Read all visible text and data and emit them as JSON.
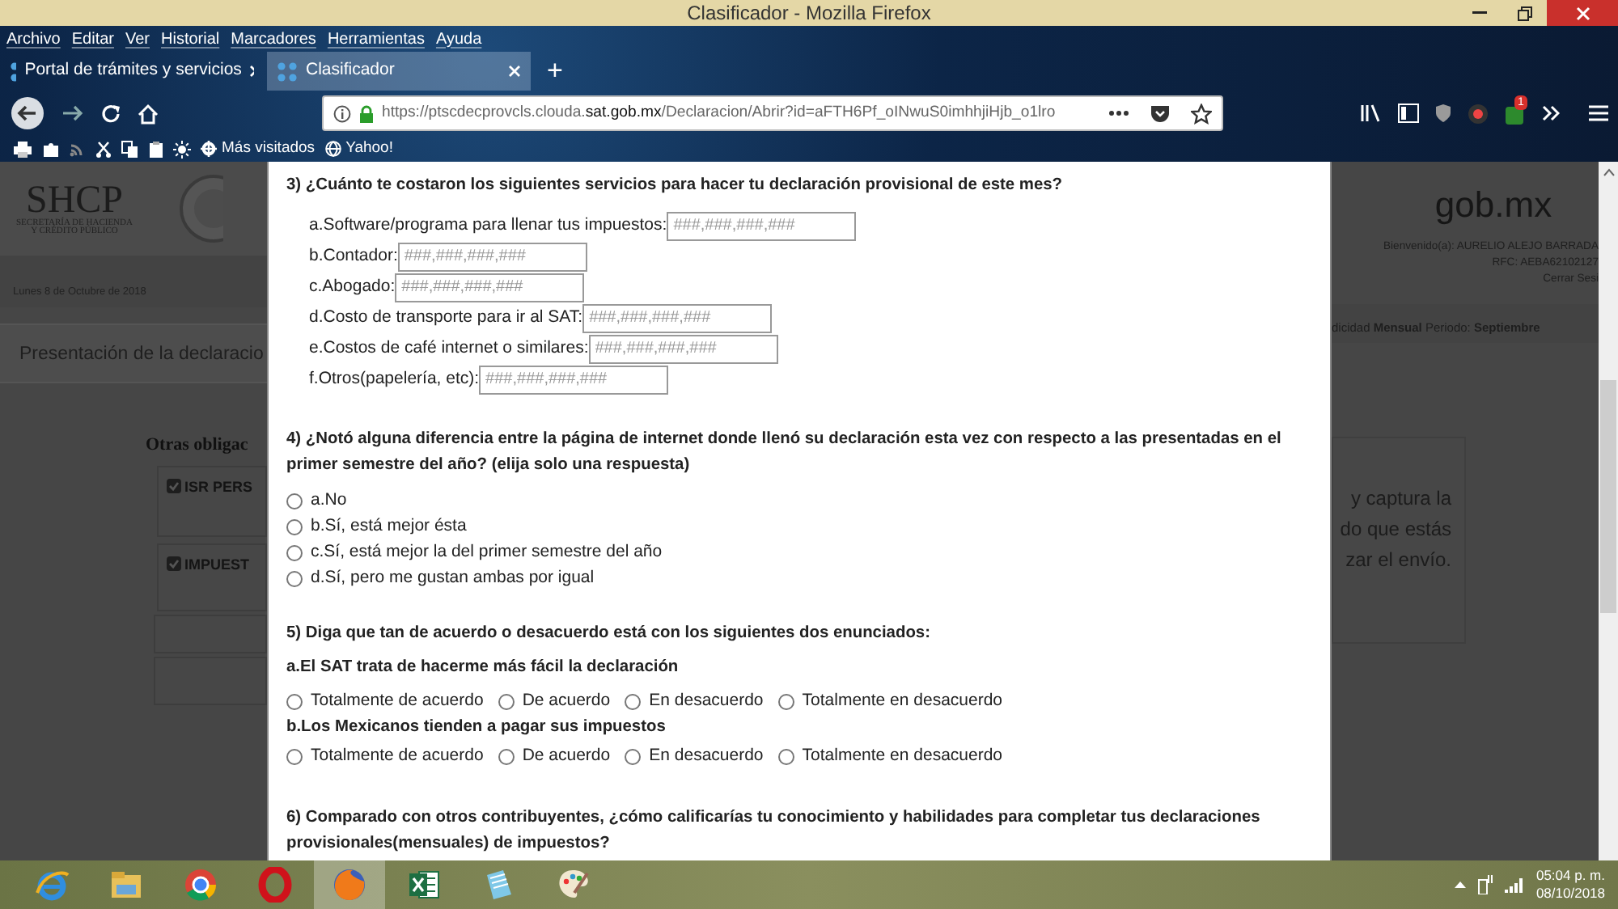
{
  "window": {
    "title": "Clasificador - Mozilla Firefox"
  },
  "menu": [
    "Archivo",
    "Editar",
    "Ver",
    "Historial",
    "Marcadores",
    "Herramientas",
    "Ayuda"
  ],
  "tabs": [
    {
      "label": "Portal de trámites y servicios",
      "selected": false
    },
    {
      "label": "Clasificador",
      "selected": true
    }
  ],
  "new_tab": "+",
  "address_bar": {
    "url_start": "https://ptscdecprovcls.clouda.",
    "url_domain": "sat.gob.mx",
    "url_end": "/Declaracion/Abrir?id=aFTH6Pf_oINwuS0imhhjiHjb_o1lro"
  },
  "toolbar_badge": "1",
  "bookmarks": [
    "Más visitados",
    "Yahoo!"
  ],
  "background_page": {
    "logo": "SHCP",
    "logo_sub_1": "SECRETARÍA DE HACIENDA",
    "logo_sub_2": "Y CRÉDITO PÚBLICO",
    "date": "Lunes 8 de Octubre de 2018",
    "section_title": "Presentación de la declaracio",
    "others_heading": "Otras obligac",
    "obligations": [
      {
        "label": "ISR PERS",
        "checked": true
      },
      {
        "label": "IMPUEST",
        "checked": true
      }
    ],
    "brand": "gob.mx",
    "welcome": "Bienvenido(a): AURELIO ALEJO BARRADA",
    "rfc": "RFC: AEBA62102127",
    "logout": "Cerrar Sesi",
    "period": "dicidad **Mensual** Periodo: **Septiembre**",
    "notice_lines": [
      "y captura la",
      "do que estás",
      "zar el envío."
    ]
  },
  "form": [
    {
      "kind": "inputs",
      "title": "3) ¿Cuánto te costaron los siguientes servicios para hacer tu declaración provisional de este mes?",
      "items": [
        {
          "label": "a.Software/programa para llenar tus impuestos:",
          "placeholder": "###,###,###,###"
        },
        {
          "label": "b.Contador:",
          "placeholder": "###,###,###,###"
        },
        {
          "label": "c.Abogado:",
          "placeholder": "###,###,###,###"
        },
        {
          "label": "d.Costo de transporte para ir al SAT:",
          "placeholder": "###,###,###,###"
        },
        {
          "label": "e.Costos de café internet o similares:",
          "placeholder": "###,###,###,###"
        },
        {
          "label": "f.Otros(papelería, etc):",
          "placeholder": "###,###,###,###"
        }
      ]
    },
    {
      "kind": "radios",
      "title": "4) ¿Notó alguna diferencia entre la página de internet donde llenó su declaración esta vez con respecto a las presentadas en el primer semestre del año? (elija solo una respuesta)",
      "options": [
        {
          "label": "a.No",
          "selected": false
        },
        {
          "label": "b.Sí, está mejor ésta",
          "selected": false
        },
        {
          "label": "c.Sí, está mejor la del primer semestre del año",
          "selected": false
        },
        {
          "label": "d.Sí, pero me gustan ambas por igual",
          "selected": false
        }
      ]
    },
    {
      "kind": "matrix",
      "title": "5) Diga que tan de acuerdo o desacuerdo está con los siguientes dos enunciados:",
      "statements": [
        {
          "label": "a.El SAT trata de hacerme más fácil la declaración",
          "options": [
            {
              "label": "Totalmente de acuerdo",
              "selected": false
            },
            {
              "label": "De acuerdo",
              "selected": false
            },
            {
              "label": "En desacuerdo",
              "selected": false
            },
            {
              "label": "Totalmente en desacuerdo",
              "selected": false
            }
          ]
        },
        {
          "label": "b.Los Mexicanos tienden a pagar sus impuestos",
          "options": [
            {
              "label": "Totalmente de acuerdo",
              "selected": false
            },
            {
              "label": "De acuerdo",
              "selected": false
            },
            {
              "label": "En desacuerdo",
              "selected": false
            },
            {
              "label": "Totalmente en desacuerdo",
              "selected": false
            }
          ]
        }
      ]
    },
    {
      "kind": "title_only",
      "title": "6) Comparado con otros contribuyentes, ¿cómo calificarías tu conocimiento y habilidades para completar tus declaraciones provisionales(mensuales) de impuestos?"
    }
  ],
  "taskbar": {
    "apps": [
      {
        "selected": false
      },
      {
        "selected": false
      },
      {
        "selected": false
      },
      {
        "selected": false
      },
      {
        "selected": true
      },
      {
        "selected": false
      },
      {
        "selected": false
      },
      {
        "selected": false
      }
    ],
    "time": "05:04 p. m.",
    "date": "08/10/2018"
  }
}
